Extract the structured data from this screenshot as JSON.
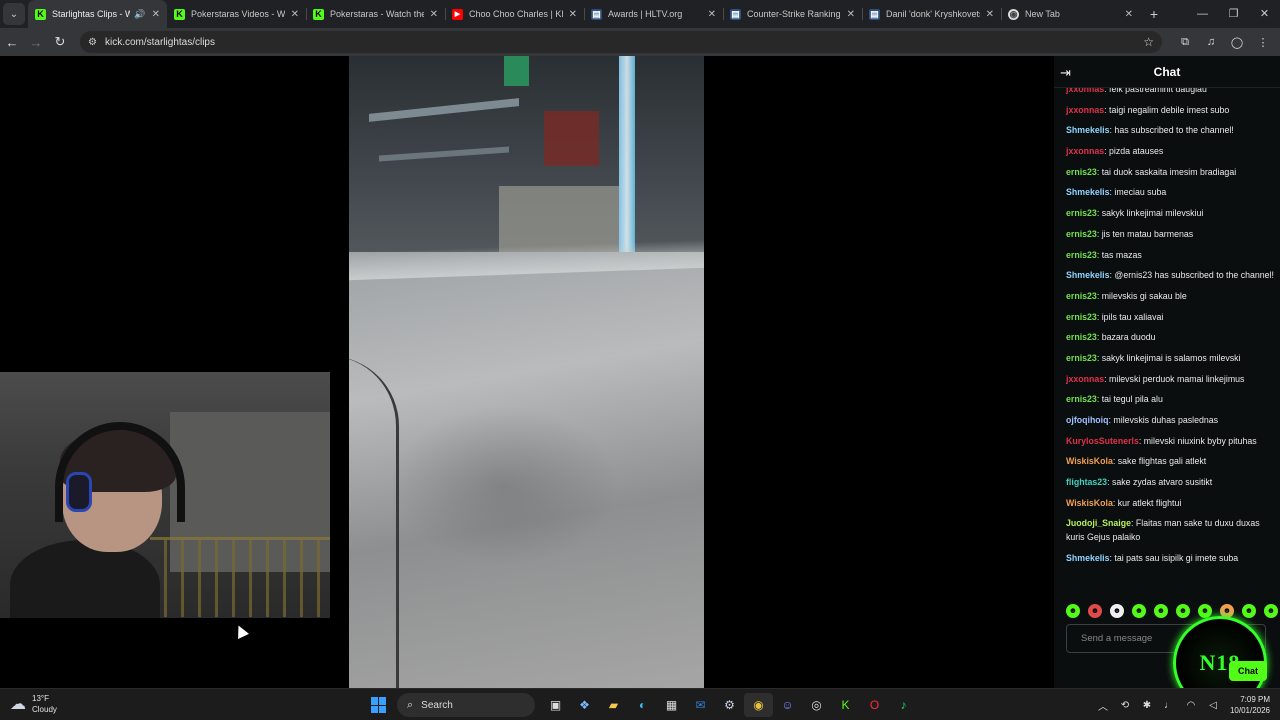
{
  "browser": {
    "tabs": [
      {
        "label": "Starlightas Clips - Wat",
        "favicon": "kick-icon",
        "active": true,
        "audio": true
      },
      {
        "label": "Pokerstaras Videos - Wat",
        "favicon": "kick-icon"
      },
      {
        "label": "Pokerstaras - Watch the V",
        "favicon": "kick-icon"
      },
      {
        "label": "Choo Choo Charles | KILL",
        "favicon": "youtube-icon"
      },
      {
        "label": "Awards | HLTV.org",
        "favicon": "hltv-icon"
      },
      {
        "label": "Counter-Strike Ranking |",
        "favicon": "hltv-icon"
      },
      {
        "label": "Danil 'donk' Kryshkovets",
        "favicon": "hltv-icon"
      },
      {
        "label": "New Tab",
        "favicon": "chrome-icon"
      }
    ],
    "url": "kick.com/starlightas/clips",
    "accent_kick": "#53fc18"
  },
  "chat": {
    "title": "Chat",
    "messages": [
      {
        "user": "jxxonnas",
        "text": "feik pastreaminit daugiau",
        "color": "#e0304a"
      },
      {
        "user": "jxxonnas",
        "text": "taigi negalim debile imest subo",
        "color": "#e0304a"
      },
      {
        "user": "Shmekelis",
        "text": "has subscribed to the channel!",
        "color": "#8fd4ff"
      },
      {
        "user": "jxxonnas",
        "text": "pizda atauses",
        "color": "#e0304a"
      },
      {
        "user": "ernis23",
        "text": "tai duok saskaita imesim bradiagai",
        "color": "#72e04b"
      },
      {
        "user": "Shmekelis",
        "text": "imeciau suba",
        "color": "#8fd4ff"
      },
      {
        "user": "ernis23",
        "text": "sakyk linkejimai milevskiui",
        "color": "#72e04b"
      },
      {
        "user": "ernis23",
        "text": "jis ten matau barmenas",
        "color": "#72e04b"
      },
      {
        "user": "ernis23",
        "text": "tas mazas",
        "color": "#72e04b"
      },
      {
        "user": "Shmekelis",
        "text": "@ernis23 has subscribed to the channel!",
        "color": "#8fd4ff"
      },
      {
        "user": "ernis23",
        "text": "milevskis gi sakau ble",
        "color": "#72e04b"
      },
      {
        "user": "ernis23",
        "text": "ipils tau xaliavai",
        "color": "#72e04b"
      },
      {
        "user": "ernis23",
        "text": "bazara duodu",
        "color": "#72e04b"
      },
      {
        "user": "ernis23",
        "text": "sakyk linkejimai is salamos milevski",
        "color": "#72e04b"
      },
      {
        "user": "jxxonnas",
        "text": "milevski perduok mamai linkejimus",
        "color": "#e0304a"
      },
      {
        "user": "ernis23",
        "text": "tai tegul pila alu",
        "color": "#72e04b"
      },
      {
        "user": "ojfoqihoiq",
        "text": "milevskis duhas paslednas",
        "color": "#9ec0ff"
      },
      {
        "user": "KurylosSutenerls",
        "text": "milevski niuxink byby pituhas",
        "color": "#e0304a"
      },
      {
        "user": "WiskisKola",
        "text": "sake flightas gali atlekt",
        "color": "#f0a050"
      },
      {
        "user": "flightas23",
        "text": "sake zydas atvaro susitikt",
        "color": "#3fd0c0"
      },
      {
        "user": "WiskisKola",
        "text": "kur atlekt flightui",
        "color": "#f0a050"
      },
      {
        "user": "Juodoji_Snaige",
        "text": "Flaitas man sake tu duxu duxas kuris Gejus palaiko",
        "color": "#b6f05a"
      },
      {
        "user": "Shmekelis",
        "text": "tai pats sau isipilk gi imete suba",
        "color": "#8fd4ff"
      }
    ],
    "input_placeholder": "Send a message",
    "chat_button": "Chat",
    "overlay_text": "N18"
  },
  "taskbar": {
    "temperature": "13°F",
    "condition": "Cloudy",
    "search_label": "Search",
    "time": "7:09 PM",
    "date": "10/01/2026"
  }
}
